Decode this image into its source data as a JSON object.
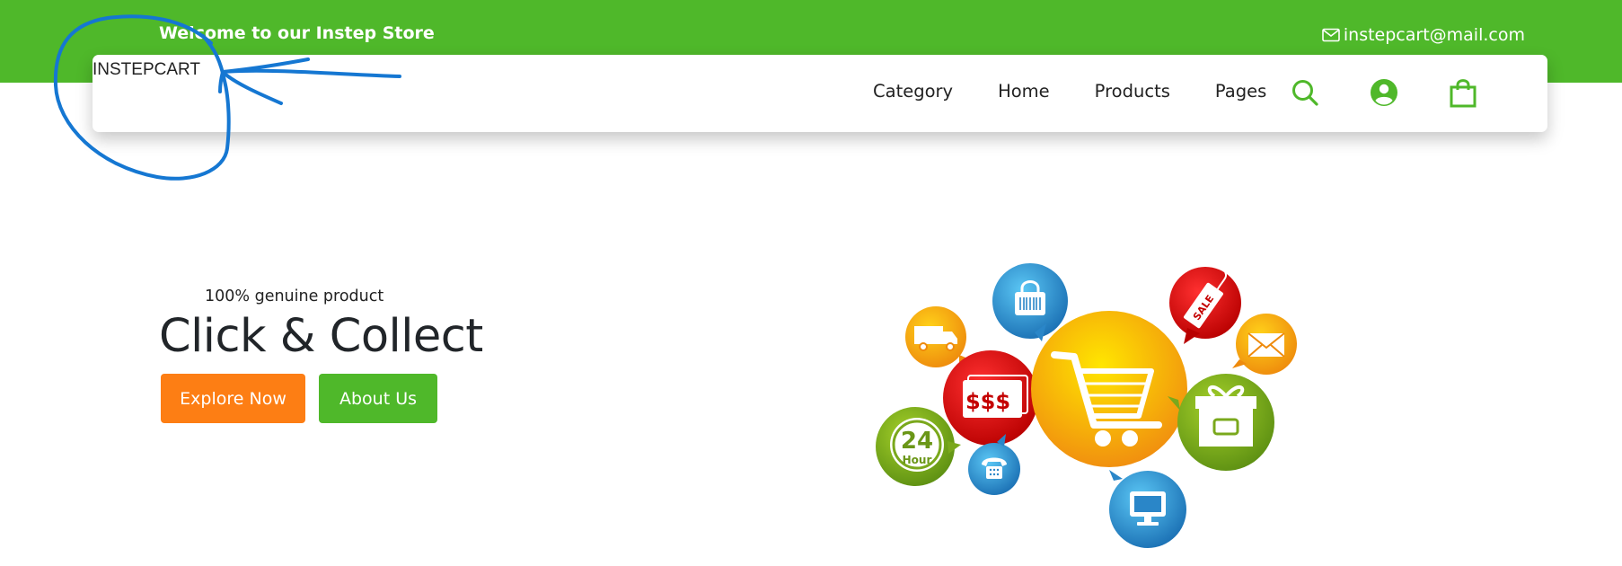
{
  "topbar": {
    "welcome_text": "Welcome to our Instep Store",
    "email": "instepcart@mail.com",
    "email_icon": "envelope-icon"
  },
  "nav": {
    "brand": "INSTEPCART",
    "items": [
      {
        "label": "Category"
      },
      {
        "label": "Home"
      },
      {
        "label": "Products"
      },
      {
        "label": "Pages"
      }
    ],
    "icons": [
      "search-icon",
      "user-account-icon",
      "shopping-bag-icon"
    ]
  },
  "hero": {
    "tagline": "100% genuine product",
    "headline": "Click & Collect",
    "explore_label": "Explore Now",
    "about_label": "About Us",
    "illustration": {
      "money_text": "$$$",
      "hours_number": "24",
      "hours_text": "Hour",
      "sale_text": "SALE"
    }
  },
  "colors": {
    "brand_green": "#4fb82a",
    "accent_orange": "#fd7e14",
    "annotation_blue": "#1577d2"
  }
}
